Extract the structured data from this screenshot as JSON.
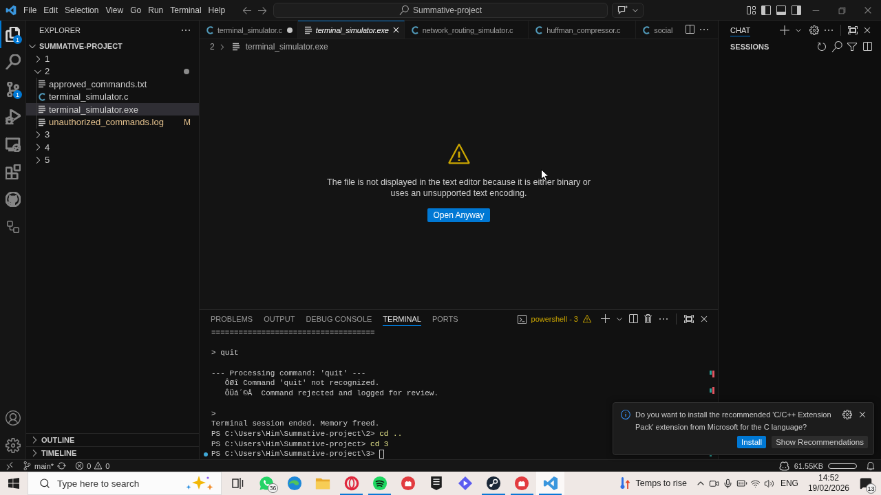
{
  "title_bar": {
    "menus": [
      "File",
      "Edit",
      "Selection",
      "View",
      "Go",
      "Run",
      "Terminal",
      "Help"
    ],
    "search": {
      "value": "Summative-project"
    }
  },
  "activity_bar": {
    "items": [
      {
        "selected": true,
        "badge": "1"
      },
      {
        "selected": false
      },
      {
        "selected": false,
        "badge": "1"
      },
      {
        "selected": false
      },
      {
        "selected": false
      },
      {
        "selected": false
      },
      {
        "selected": false
      },
      {
        "selected": false
      }
    ]
  },
  "sidebar": {
    "title": "EXPLORER",
    "root": {
      "label": "SUMMATIVE-PROJECT",
      "expanded": true
    },
    "tree": [
      {
        "kind": "folder",
        "label": "1",
        "expanded": false,
        "selected": false,
        "has_changes": false
      },
      {
        "kind": "folder",
        "label": "2",
        "expanded": true,
        "selected": false,
        "has_changes": true,
        "children": [
          {
            "kind": "text",
            "label": "approved_commands.txt",
            "selected": false
          },
          {
            "kind": "c",
            "label": "terminal_simulator.c",
            "selected": false
          },
          {
            "kind": "text",
            "label": "terminal_simulator.exe",
            "selected": true
          },
          {
            "kind": "text",
            "label": "unauthorized_commands.log",
            "selected": false,
            "git_status": "M"
          }
        ]
      },
      {
        "kind": "folder",
        "label": "3",
        "expanded": false,
        "selected": false,
        "has_changes": false
      },
      {
        "kind": "folder",
        "label": "4",
        "expanded": false,
        "selected": false,
        "has_changes": false
      },
      {
        "kind": "folder",
        "label": "5",
        "expanded": false,
        "selected": false,
        "has_changes": false
      }
    ],
    "sections": [
      {
        "label": "OUTLINE",
        "expanded": false
      },
      {
        "label": "TIMELINE",
        "expanded": false
      }
    ]
  },
  "editor": {
    "tabs": [
      {
        "kind": "c",
        "label": "terminal_simulator.c",
        "selected": false,
        "dirty": true,
        "preview": false
      },
      {
        "kind": "text",
        "label": "terminal_simulator.exe",
        "selected": true,
        "dirty": false,
        "preview": true
      },
      {
        "kind": "c",
        "label": "network_routing_simulator.c",
        "selected": false,
        "dirty": false,
        "preview": false
      },
      {
        "kind": "c",
        "label": "huffman_compressor.c",
        "selected": false,
        "dirty": false,
        "preview": false
      },
      {
        "kind": "c",
        "label": "social",
        "selected": false,
        "dirty": false,
        "preview": false
      }
    ],
    "breadcrumb": [
      "2",
      "terminal_simulator.exe"
    ],
    "notice": {
      "message": "The file is not displayed in the text editor because it is either binary or uses an unsupported text encoding.",
      "button": "Open Anyway"
    }
  },
  "panel": {
    "tabs": [
      {
        "label": "PROBLEMS",
        "selected": false
      },
      {
        "label": "OUTPUT",
        "selected": false
      },
      {
        "label": "DEBUG CONSOLE",
        "selected": false
      },
      {
        "label": "TERMINAL",
        "selected": true
      },
      {
        "label": "PORTS",
        "selected": false
      }
    ],
    "terminal_name": "powershell - 3",
    "lines": [
      {
        "kind": "output",
        "text": "====================================",
        "indented": false
      },
      {
        "kind": "blank"
      },
      {
        "kind": "output",
        "text": "> quit",
        "indented": false
      },
      {
        "kind": "blank"
      },
      {
        "kind": "output",
        "text": "--- Processing command: 'quit' ---",
        "indented": false
      },
      {
        "kind": "output",
        "text": "ÔØî Command 'quit' not recognized.",
        "indented": true
      },
      {
        "kind": "output",
        "text": "ÔÜá´©Å  Command rejected and logged for review.",
        "indented": true
      },
      {
        "kind": "blank"
      },
      {
        "kind": "output",
        "text": ">",
        "indented": false
      },
      {
        "kind": "output",
        "text": "Terminal session ended. Memory freed.",
        "indented": false
      },
      {
        "kind": "prompt",
        "prompt": "PS C:\\Users\\Him\\Summative-project\\2>",
        "command": "cd ..",
        "marker": false,
        "cursor": false
      },
      {
        "kind": "prompt",
        "prompt": "PS C:\\Users\\Him\\Summative-project>",
        "command": "cd 3",
        "marker": false,
        "cursor": false
      },
      {
        "kind": "prompt",
        "prompt": "PS C:\\Users\\Him\\Summative-project\\3>",
        "marker": true,
        "cursor": true
      }
    ]
  },
  "chat": {
    "tabs": [
      {
        "label": "CHAT",
        "selected": true
      }
    ],
    "section": "SESSIONS"
  },
  "notification": {
    "message": "Do you want to install the recommended 'C/C++ Extension Pack' extension from Microsoft for the C language?",
    "buttons": [
      {
        "label": "Install",
        "primary": true
      },
      {
        "label": "Show Recommendations",
        "primary": false
      }
    ]
  },
  "status_bar": {
    "branch": "main*",
    "errors": "0",
    "warnings": "0",
    "file_size": "61.55KB"
  },
  "taskbar": {
    "search": {
      "placeholder": "Type here to search"
    },
    "apps": [
      {
        "selected": false,
        "running": false,
        "badge": "36"
      },
      {
        "selected": false,
        "running": false
      },
      {
        "selected": false,
        "running": false
      },
      {
        "selected": false,
        "running": true
      },
      {
        "selected": false,
        "running": true
      },
      {
        "selected": false,
        "running": false
      },
      {
        "selected": false,
        "running": false
      },
      {
        "selected": false,
        "running": false
      },
      {
        "selected": false,
        "running": true
      },
      {
        "selected": false,
        "running": true
      },
      {
        "selected": true,
        "running": true
      }
    ],
    "weather": "Temps to rise",
    "language": "ENG",
    "time": "14:52",
    "date": "19/02/2026",
    "notification_count": "13"
  }
}
